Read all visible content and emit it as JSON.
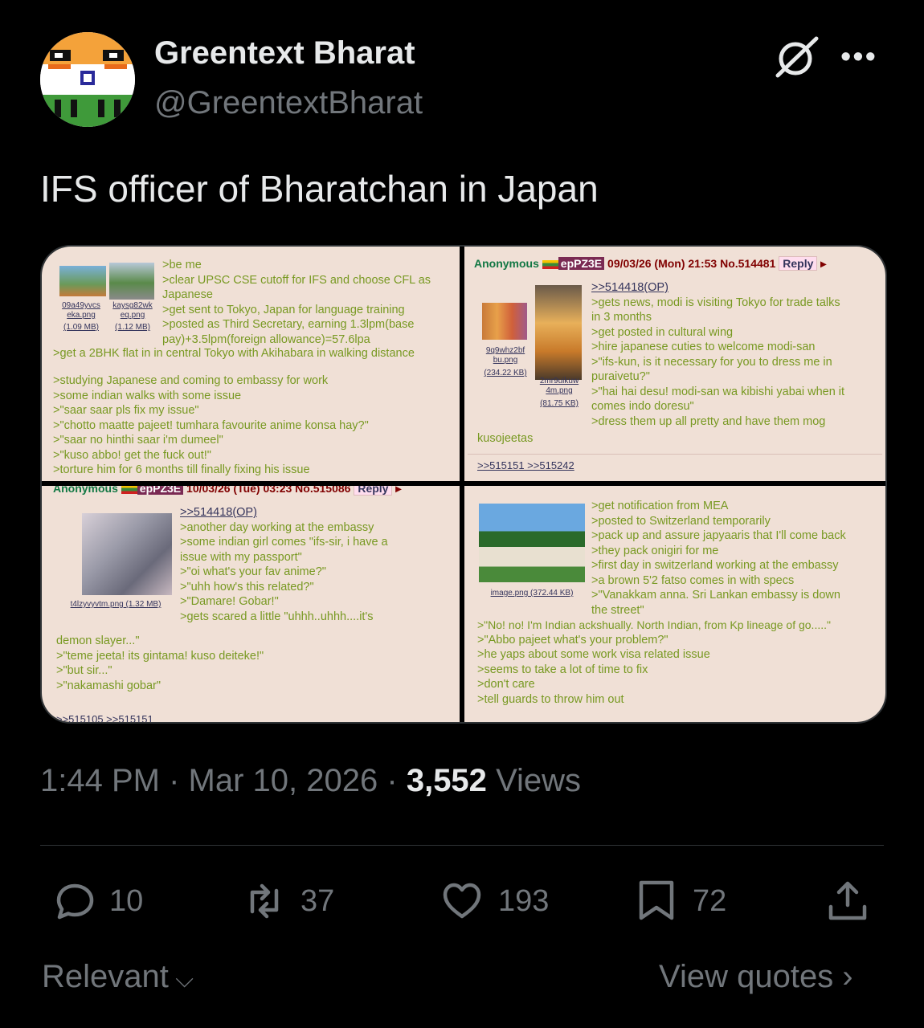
{
  "author": {
    "name": "Greentext Bharat",
    "handle": "@GreentextBharat"
  },
  "tweet": {
    "text": "IFS officer of Bharatchan in Japan"
  },
  "media": {
    "p1": {
      "thumb1_file": "09a49yvcs eka.png",
      "thumb1_size": "(1.09 MB)",
      "thumb2_file": "kaysg82wk eq.png",
      "thumb2_size": "(1.12 MB)",
      "lines": [
        ">be me",
        ">clear UPSC CSE cutoff for IFS and choose CFL as",
        "Japanese",
        ">get sent to Tokyo, Japan for language training",
        ">posted as Third Secretary, earning 1.3lpm(base",
        "pay)+3.5lpm(foreign allowance)=57.6lpa"
      ],
      "line_full": ">get a 2BHK flat in in central Tokyo with Akihabara in walking distance",
      "lines2": [
        ">studying Japanese and coming to embassy for work",
        ">some indian walks with some issue",
        ">\"saar saar pls fix my issue\"",
        ">\"chotto maatte pajeet! tumhara favourite anime konsa hay?\"",
        ">\"saar no hinthi saar i'm dumeel\"",
        ">\"kuso abbo! get the fuck out!\"",
        ">torture him for 6 months till finally fixing his issue"
      ]
    },
    "p2": {
      "name": "Anonymous",
      "id": "epPZ3E",
      "datetime": "09/03/26 (Mon) 21:53 No.514481",
      "reply": "Reply",
      "quote": ">>514418(OP)",
      "thumb1_file": "9q9whz2bf bu.png",
      "thumb1_size": "(234.22 KB)",
      "thumb2_file": "2mr9uikuw 4m.png",
      "thumb2_size": "(81.75 KB)",
      "lines": [
        ">gets news, modi is visiting Tokyo for trade talks",
        "in 3 months",
        ">get posted in cultural wing",
        ">hire japanese cuties to welcome modi-san",
        ">\"ifs-kun, is it necessary for you to dress me in",
        "puraivetu?\"",
        ">\"hai hai desu! modi-san wa kibishi yabai when it",
        "comes indo doresu\"",
        ">dress them up all pretty and have them mog"
      ],
      "tail": "kusojeetas",
      "backlinks": ">>515151 >>515242"
    },
    "p3": {
      "name": "Anonymous",
      "id": "epPZ3E",
      "datetime": "10/03/26 (Tue) 03:23 No.515086",
      "reply": "Reply",
      "quote": ">>514418(OP)",
      "file": "t4lzyvyvtm.png (1.32 MB)",
      "lines": [
        ">another day working at the embassy",
        ">some indian girl comes \"ifs-sir, i have a",
        "issue with my passport\"",
        ">\"oi what's your fav anime?\"",
        ">\"uhh how's this related?\"",
        ">\"Damare! Gobar!\"",
        ">gets scared a little \"uhhh..uhhh....it's"
      ],
      "lines2": [
        "demon slayer...\"",
        ">\"teme jeeta! its gintama! kuso deiteke!\"",
        ">\"but sir...\"",
        ">\"nakamashi gobar\""
      ],
      "backlinks": ">>515105 >>515151"
    },
    "p4": {
      "file": "image.png (372.44 KB)",
      "lines": [
        ">get notification from MEA",
        ">posted to Switzerland temporarily",
        ">pack up and assure japyaaris that I'll come back",
        ">they pack onigiri for me",
        ">first day in switzerland working at the embassy",
        ">a brown 5'2 fatso comes in with specs",
        ">\"Vanakkam anna. Sri Lankan embassy is down",
        "the street\""
      ],
      "lines2": [
        ">\"No! no! I'm Indian ackshually. North Indian, from Kp lineage of go.....\"",
        ">\"Abbo pajeet what's your problem?\"",
        ">he yaps about some work visa related issue",
        ">seems to take a lot of time to fix",
        ">don't care",
        ">tell guards to throw him out"
      ]
    }
  },
  "meta": {
    "time": "1:44 PM",
    "sep1": "·",
    "date": "Mar 10, 2026",
    "sep2": "·",
    "views_count": "3,552",
    "views_label": "Views"
  },
  "actions": {
    "replies": "10",
    "reposts": "37",
    "likes": "193",
    "bookmarks": "72"
  },
  "footer": {
    "sort_label": "Relevant",
    "quotes_label": "View quotes"
  },
  "colors": {
    "background": "#000000",
    "text_primary": "#e7e9ea",
    "text_secondary": "#71767b",
    "board_bg": "#f0e0d6",
    "greentext": "#789922"
  }
}
